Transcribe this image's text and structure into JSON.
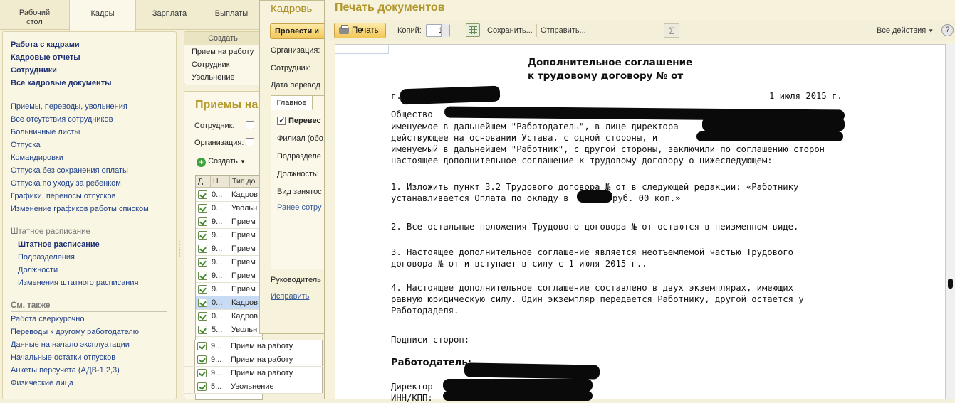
{
  "top_tabs": [
    {
      "label": "Рабочий\nстол"
    },
    {
      "label": "Кадры"
    },
    {
      "label": "Зарплата"
    },
    {
      "label": "Выплаты"
    }
  ],
  "nav": {
    "main": [
      "Работа с кадрами",
      "Кадровые отчеты",
      "Сотрудники",
      "Все кадровые документы"
    ],
    "items": [
      "Приемы, переводы, увольнения",
      "Все отсутствия сотрудников",
      "Больничные листы",
      "Отпуска",
      "Командировки",
      "Отпуска без сохранения оплаты",
      "Отпуска по уходу за ребенком",
      "Графики, переносы отпусков",
      "Изменение графиков работы списком"
    ],
    "staff_header": "Штатное расписание",
    "staff_items": [
      "Штатное расписание",
      "Подразделения",
      "Должности",
      "Изменения штатного расписания"
    ],
    "see_also_header": "См. также",
    "see_also": [
      "Работа сверхурочно",
      "Переводы к другому работодателю",
      "Данные на начало эксплуатации",
      "Начальные остатки отпусков",
      "Анкеты персучета (АДВ-1,2,3)",
      "Физические лица"
    ]
  },
  "create_menu": {
    "header": "Создать",
    "items": [
      "Прием на работу",
      "Сотрудник",
      "Увольнение"
    ]
  },
  "list": {
    "title": "Приемы на",
    "employee_label": "Сотрудник:",
    "org_label": "Организация:",
    "create_btn": "Создать",
    "headers": [
      "Д.",
      "Н...",
      "Тип до"
    ],
    "rows": [
      {
        "n": "0...",
        "type": "Кадров",
        "selected": false
      },
      {
        "n": "0...",
        "type": "Увольн",
        "selected": false
      },
      {
        "n": "9...",
        "type": "Прием",
        "selected": false
      },
      {
        "n": "9...",
        "type": "Прием",
        "selected": false
      },
      {
        "n": "9...",
        "type": "Прием",
        "selected": false
      },
      {
        "n": "9...",
        "type": "Прием",
        "selected": false
      },
      {
        "n": "9...",
        "type": "Прием",
        "selected": false
      },
      {
        "n": "9...",
        "type": "Прием",
        "selected": false
      },
      {
        "n": "0...",
        "type": "Кадров",
        "selected": true
      },
      {
        "n": "0...",
        "type": "Кадров",
        "selected": false
      },
      {
        "n": "5...",
        "type": "Увольн",
        "selected": false
      }
    ],
    "wide_rows": [
      {
        "n": "9...",
        "type": "Прием на работу"
      },
      {
        "n": "9...",
        "type": "Прием на работу"
      },
      {
        "n": "9...",
        "type": "Прием на работу"
      },
      {
        "n": "5...",
        "type": "Увольнение"
      }
    ]
  },
  "kadr_doc": {
    "title": "Кадровь",
    "post_btn": "Провести и",
    "labels": [
      "Организация:",
      "Сотрудник:",
      "Дата перевод"
    ],
    "tab": "Главное",
    "check_label": "Перевес",
    "inner_labels": [
      "Филиал (обо",
      "Подразделе",
      "Должность:",
      "Вид занятос"
    ],
    "link": "Ранее сотру",
    "manager_label": "Руководитель",
    "fix_link": "Исправить"
  },
  "print_window": {
    "title": "Печать документов",
    "print_btn": "Печать",
    "copies_label": "Копий:",
    "copies_value": "1",
    "save_btn": "Сохранить...",
    "send_btn": "Отправить...",
    "sigma": "Σ",
    "all_actions": "Все действия",
    "help": "?"
  },
  "document": {
    "title_line1": "Дополнительное соглашение",
    "title_line2": "к трудовому договору  №  от",
    "city_prefix": "г.",
    "date": "1 июля 2015 г.",
    "p1_start": "Общество",
    "p1_l2": "именуемое в дальнейшем \"Работодатель\", в лице директора",
    "p1_l3": "действующее на основании Устава, с одной стороны, и",
    "p1_l4": "именуемый в дальнейшем \"Работник\", с другой стороны, заключили по соглашению сторон",
    "p1_l5": "настоящее дополнительное соглашение к трудовому договору о нижеследующем:",
    "i1_l1": "1.  Изложить пункт 3.2 Трудового договора №  от    в следующей редакции:  «Работнику",
    "i1_l2a": "устанавливается Оплата по окладу в",
    "i1_l2b": "руб. 00 коп.»",
    "i2": "2.  Все остальные положения Трудового договора №  от  остаются в неизменном виде.",
    "i3_l1": "3.   Настоящее дополнительное соглашение является неотъемлемой частью Трудового",
    "i3_l2": "договора №  от  и вступает в силу с 1 июля 2015 г..",
    "i4_l1": "4.   Настоящее дополнительное соглашение составлено в двух экземплярах, имеющих",
    "i4_l2": "равную юридическую силу. Один экземпляр передается Работнику, другой остается у",
    "i4_l3": "Работодаделя.",
    "signatures": "Подписи сторон:",
    "employer": "Работодатель:",
    "director": "Директор",
    "inn": "ИНН/КПП:"
  }
}
